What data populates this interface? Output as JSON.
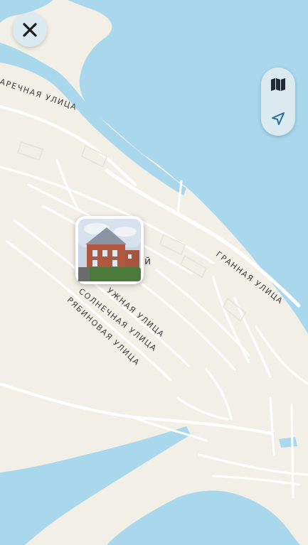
{
  "controls": {
    "close_icon": "close-icon",
    "layers_icon": "map-layers-icon",
    "locate_icon": "navigation-arrow-icon"
  },
  "streets": {
    "zarechnaya": "АРЕЧНАЯ УЛИЦА",
    "granaya": "ГРАННАЯ УЛИЦА",
    "yuzhnaya": "УЖНАЯ УЛИЦА",
    "solnechnaya": "СОЛНЕЧНАЯ УЛИЦА",
    "ryabinovaya": "РЯБИНОВАЯ УЛИЦА"
  },
  "marker": {
    "type": "photo",
    "subject": "two-storey brick house",
    "partial_label": "й"
  },
  "colors": {
    "water": "#a9d7ec",
    "land": "#f2efe6",
    "road": "#ffffff",
    "button_bg": "#dbe9f0",
    "icon": "#2a6f97"
  }
}
